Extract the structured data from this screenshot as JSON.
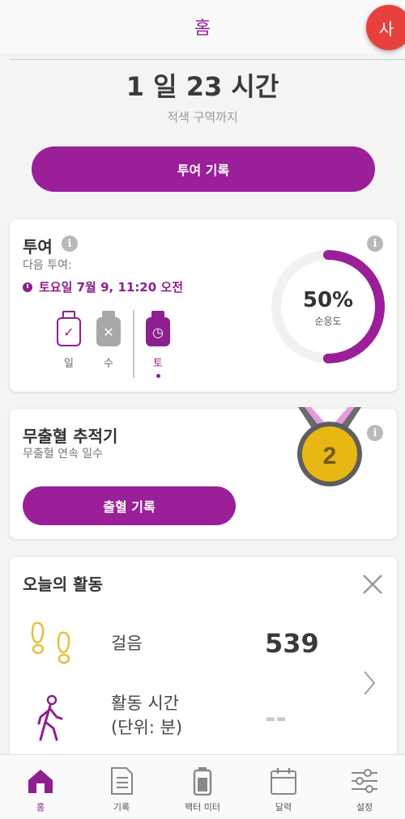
{
  "header": {
    "title": "홈",
    "avatar_initial": "사"
  },
  "countdown": {
    "value": "1 일 23 시간",
    "subtitle": "적색 구역까지"
  },
  "log_dose_button": "투여 기록",
  "dose_card": {
    "title": "투여",
    "next_label": "다음 투여:",
    "next_datetime": "토요일 7월 9, 11:20 오전",
    "days": [
      {
        "label": "일",
        "status": "taken"
      },
      {
        "label": "수",
        "status": "missed"
      },
      {
        "label": "토",
        "status": "upcoming",
        "selected": true
      }
    ],
    "compliance": {
      "percent": 50,
      "percent_text": "50%",
      "label": "순응도"
    }
  },
  "bleed_card": {
    "title": "무출혈 추적기",
    "subtitle": "무출혈 연속 일수",
    "streak_days": "2",
    "button": "출혈 기록"
  },
  "activity_card": {
    "title": "오늘의 활동",
    "rows": [
      {
        "label": "걸음",
        "value": "539",
        "icon": "footprints-icon"
      },
      {
        "label": "활동 시간\n(단위: 분)",
        "label_line1": "활동 시간",
        "label_line2": "(단위: 분)",
        "value": "--",
        "icon": "walking-person-icon"
      }
    ]
  },
  "bottom_nav": [
    {
      "label": "홈",
      "icon": "home-icon",
      "active": true
    },
    {
      "label": "기록",
      "icon": "document-icon",
      "active": false
    },
    {
      "label": "팩터 미터",
      "icon": "factor-meter-icon",
      "active": false
    },
    {
      "label": "달력",
      "icon": "calendar-icon",
      "active": false
    },
    {
      "label": "설정",
      "icon": "settings-sliders-icon",
      "active": false
    }
  ],
  "colors": {
    "brand": "#9a1f98",
    "avatar": "#e8403a",
    "medal_gold": "#e9b714",
    "steps_icon": "#e2c23a"
  }
}
